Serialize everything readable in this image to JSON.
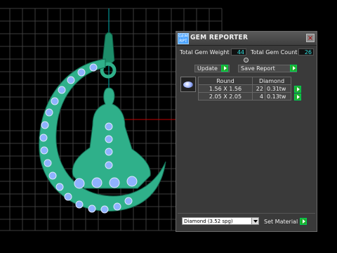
{
  "panel": {
    "icon_text": "GEM RPT",
    "title": "GEM REPORTER",
    "close_glyph": "×",
    "total_weight_label": "Total Gem Weight",
    "total_weight_value": "44",
    "total_count_label": "Total Gem Count",
    "total_count_value": "26",
    "update_label": "Update",
    "save_report_label": "Save Report",
    "table": {
      "headers": [
        "Round",
        "Diamond"
      ],
      "rows": [
        {
          "size": "1.56 X 1.56",
          "count": "22",
          "weight": "0.31tw"
        },
        {
          "size": "2.05 X 2.05",
          "count": "4",
          "weight": "0.13tw"
        }
      ]
    },
    "material_select": "Diamond    (3.52 spg)",
    "set_material_label": "Set Material"
  },
  "colors": {
    "pendant": "#2fb08a",
    "gem": "#8fb2ff",
    "axis_red": "#c00000",
    "axis_cyan": "#00b0b0",
    "go_green": "#1fae2c",
    "value_cyan": "#33e0e0"
  }
}
